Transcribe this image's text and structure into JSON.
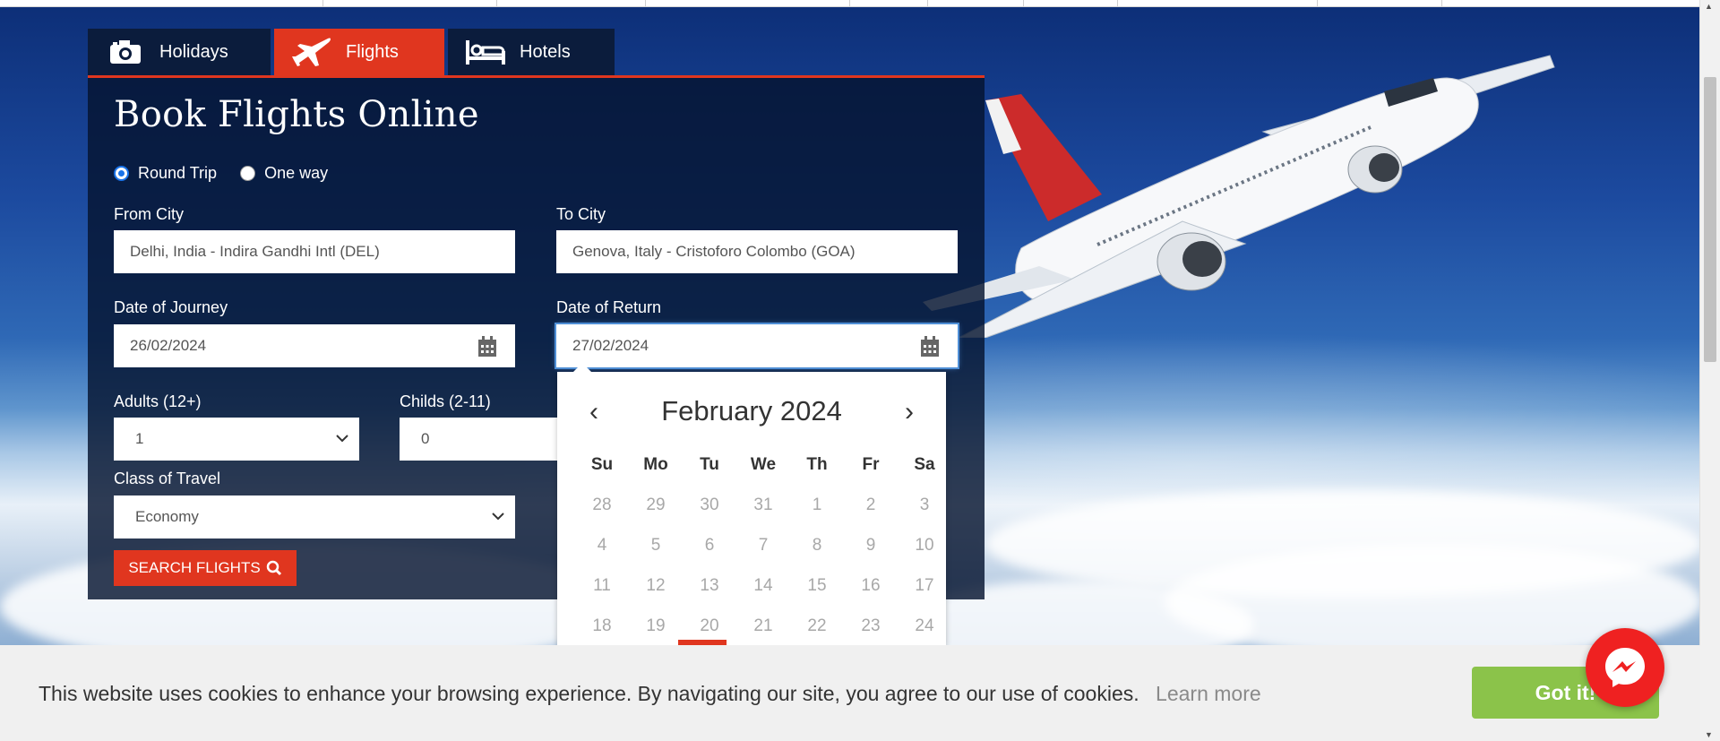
{
  "tabs": [
    {
      "label": "Holidays",
      "icon": "camera-icon",
      "active": false
    },
    {
      "label": "Flights",
      "icon": "airplane-icon",
      "active": true
    },
    {
      "label": "Hotels",
      "icon": "bed-icon",
      "active": false
    }
  ],
  "form": {
    "title": "Book Flights Online",
    "trip_types": [
      {
        "label": "Round Trip",
        "checked": true
      },
      {
        "label": "One way",
        "checked": false
      }
    ],
    "from_label": "From City",
    "from_value": "Delhi, India - Indira Gandhi Intl (DEL)",
    "to_label": "To City",
    "to_value": "Genova, Italy - Cristoforo Colombo (GOA)",
    "journey_label": "Date of Journey",
    "journey_value": "26/02/2024",
    "return_label": "Date of Return",
    "return_value": "27/02/2024",
    "adults_label": "Adults (12+)",
    "adults_value": "1",
    "childs_label": "Childs (2-11)",
    "childs_value": "0",
    "class_label": "Class of Travel",
    "class_value": "Economy",
    "search_label": "SEARCH FLIGHTS"
  },
  "datepicker": {
    "prev": "‹",
    "next": "›",
    "month_title": "February 2024",
    "weekdays": [
      "Su",
      "Mo",
      "Tu",
      "We",
      "Th",
      "Fr",
      "Sa"
    ],
    "weeks": [
      [
        "28",
        "29",
        "30",
        "31",
        "1",
        "2",
        "3"
      ],
      [
        "4",
        "5",
        "6",
        "7",
        "8",
        "9",
        "10"
      ],
      [
        "11",
        "12",
        "13",
        "14",
        "15",
        "16",
        "17"
      ],
      [
        "18",
        "19",
        "20",
        "21",
        "22",
        "23",
        "24"
      ]
    ]
  },
  "cookie": {
    "message": "This website uses cookies to enhance your browsing experience. By navigating our site, you agree to our use of cookies.",
    "learn_more": "Learn more",
    "button": "Got it!"
  },
  "colors": {
    "accent_red": "#e0361f",
    "panel_bg": "#051430",
    "cookie_button": "#8bc34a",
    "messenger": "#ef2121"
  }
}
